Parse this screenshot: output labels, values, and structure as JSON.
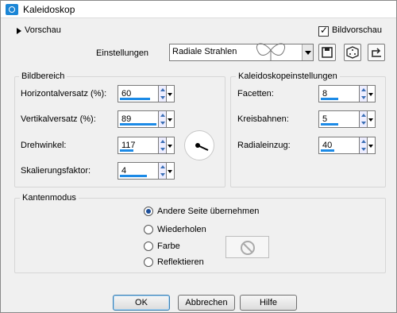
{
  "window": {
    "title": "Kaleidoskop"
  },
  "preview": {
    "label": "Vorschau",
    "bildvorschau_label": "Bildvorschau",
    "bildvorschau_checked": true
  },
  "settings": {
    "label": "Einstellungen",
    "value": "Radiale Strahlen"
  },
  "bildbereich": {
    "title": "Bildbereich",
    "fields": [
      {
        "label": "Horizontalversatz (%):",
        "value": "60",
        "fill": 0.8
      },
      {
        "label": "Vertikalversatz (%):",
        "value": "89",
        "fill": 0.95
      },
      {
        "label": "Drehwinkel:",
        "value": "117",
        "fill": 0.35
      },
      {
        "label": "Skalierungsfaktor:",
        "value": "4",
        "fill": 0.7
      }
    ]
  },
  "kaleido": {
    "title": "Kaleidoskopeinstellungen",
    "fields": [
      {
        "label": "Facetten:",
        "value": "8",
        "fill": 0.45
      },
      {
        "label": "Kreisbahnen:",
        "value": "5",
        "fill": 0.45
      },
      {
        "label": "Radialeinzug:",
        "value": "40",
        "fill": 0.35
      }
    ]
  },
  "kantenmodus": {
    "title": "Kantenmodus",
    "options": [
      "Andere Seite übernehmen",
      "Wiederholen",
      "Farbe",
      "Reflektieren"
    ],
    "selected": 0
  },
  "buttons": {
    "ok": "OK",
    "cancel": "Abbrechen",
    "help": "Hilfe"
  }
}
